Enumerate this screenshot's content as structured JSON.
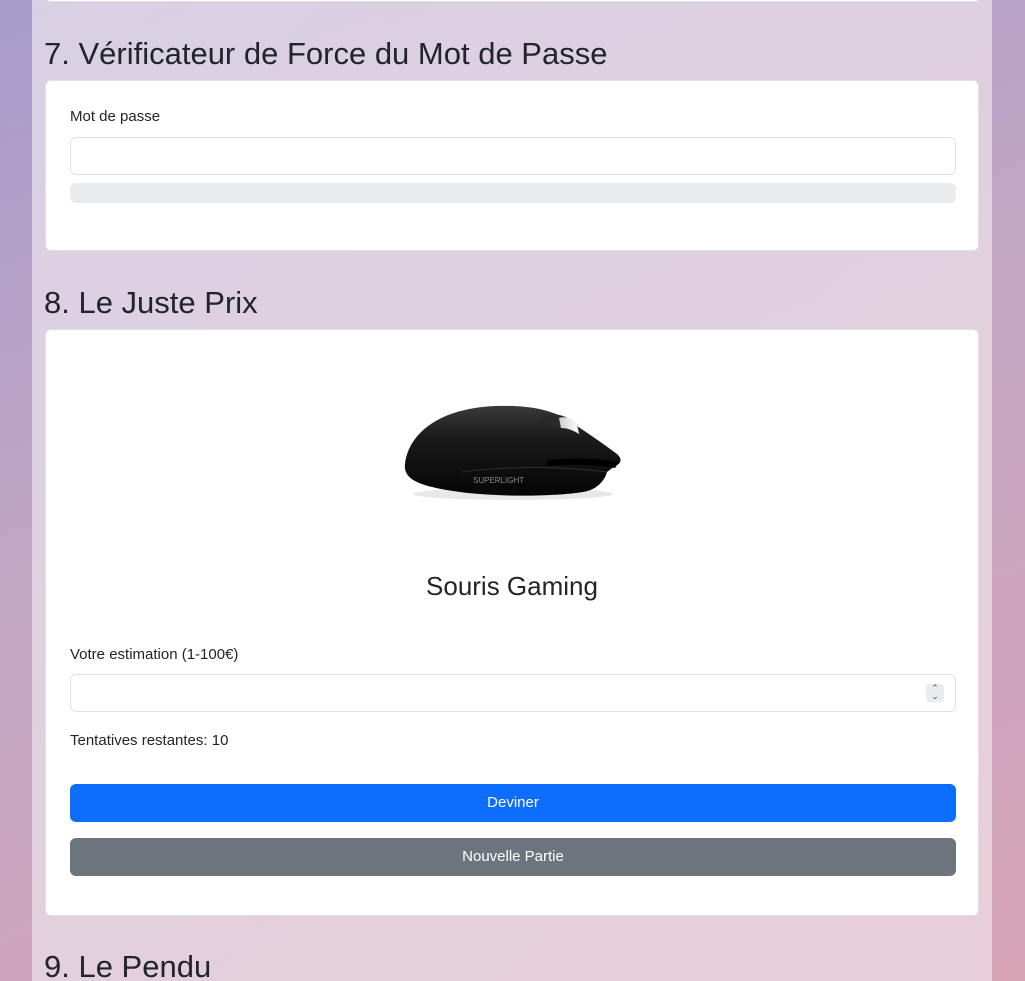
{
  "sections": {
    "password": {
      "title": "7. Vérificateur de Force du Mot de Passe",
      "label": "Mot de passe",
      "value": "",
      "strength_fraction": 0
    },
    "price_game": {
      "title": "8. Le Juste Prix",
      "product_image_text": "SUPERLIGHT",
      "product_name": "Souris Gaming",
      "guess_label": "Votre estimation (1-100€)",
      "guess_value": "",
      "attempts_text": "Tentatives restantes: 10",
      "guess_button": "Deviner",
      "new_game_button": "Nouvelle Partie"
    },
    "hangman": {
      "title": "9. Le Pendu"
    }
  },
  "colors": {
    "primary": "#0d6efd",
    "secondary": "#6c757d",
    "progress_track": "#e9ecef"
  }
}
